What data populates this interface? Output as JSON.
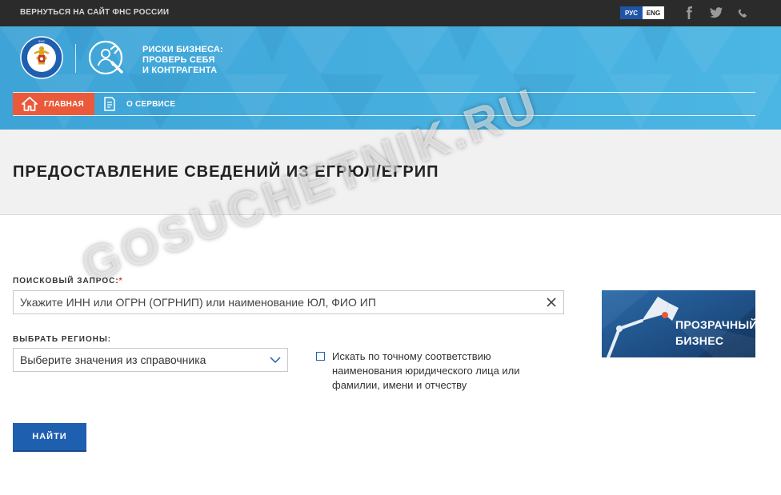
{
  "topbar": {
    "back_link": "ВЕРНУТЬСЯ НА САЙТ ФНС РОССИИ",
    "lang_ru": "РУС",
    "lang_en": "ENG",
    "icons": [
      "facebook-icon",
      "twitter-icon",
      "phone-icon"
    ]
  },
  "header": {
    "brand_lines": [
      "РИСКИ БИЗНЕСА:",
      "ПРОВЕРЬ СЕБЯ",
      "И КОНТРАГЕНТА"
    ],
    "emblem_text": "ФЕДЕРАЛЬНАЯ НАЛОГОВАЯ СЛУЖБА",
    "nav": [
      {
        "label": "ГЛАВНАЯ",
        "active": true,
        "icon": "home-icon"
      },
      {
        "label": "О СЕРВИСЕ",
        "active": false,
        "icon": "document-icon"
      }
    ]
  },
  "page": {
    "title": "ПРЕДОСТАВЛЕНИЕ СВЕДЕНИЙ ИЗ ЕГРЮЛ/ЕГРИП"
  },
  "form": {
    "query_label": "ПОИСКОВЫЙ ЗАПРОС:",
    "query_required_mark": "*",
    "query_placeholder": "Укажите ИНН или ОГРН (ОГРНИП) или наименование ЮЛ, ФИО ИП",
    "region_label": "ВЫБРАТЬ РЕГИОНЫ:",
    "region_placeholder": "Выберите значения из справочника",
    "exact_match_label": "Искать по точному соответствию наименования юридического лица или фамилии, имени и отчеству",
    "exact_match_checked": false,
    "submit_label": "НАЙТИ"
  },
  "banner": {
    "line1": "ПРОЗРАЧНЫЙ",
    "line2": "БИЗНЕС"
  },
  "watermark": "GOSUCHETNIK.RU",
  "colors": {
    "topbar": "#2b2b2b",
    "hero": "#45aedf",
    "nav_active": "#ea5a3a",
    "button": "#1f5fb0",
    "banner": "#1d4a80"
  }
}
